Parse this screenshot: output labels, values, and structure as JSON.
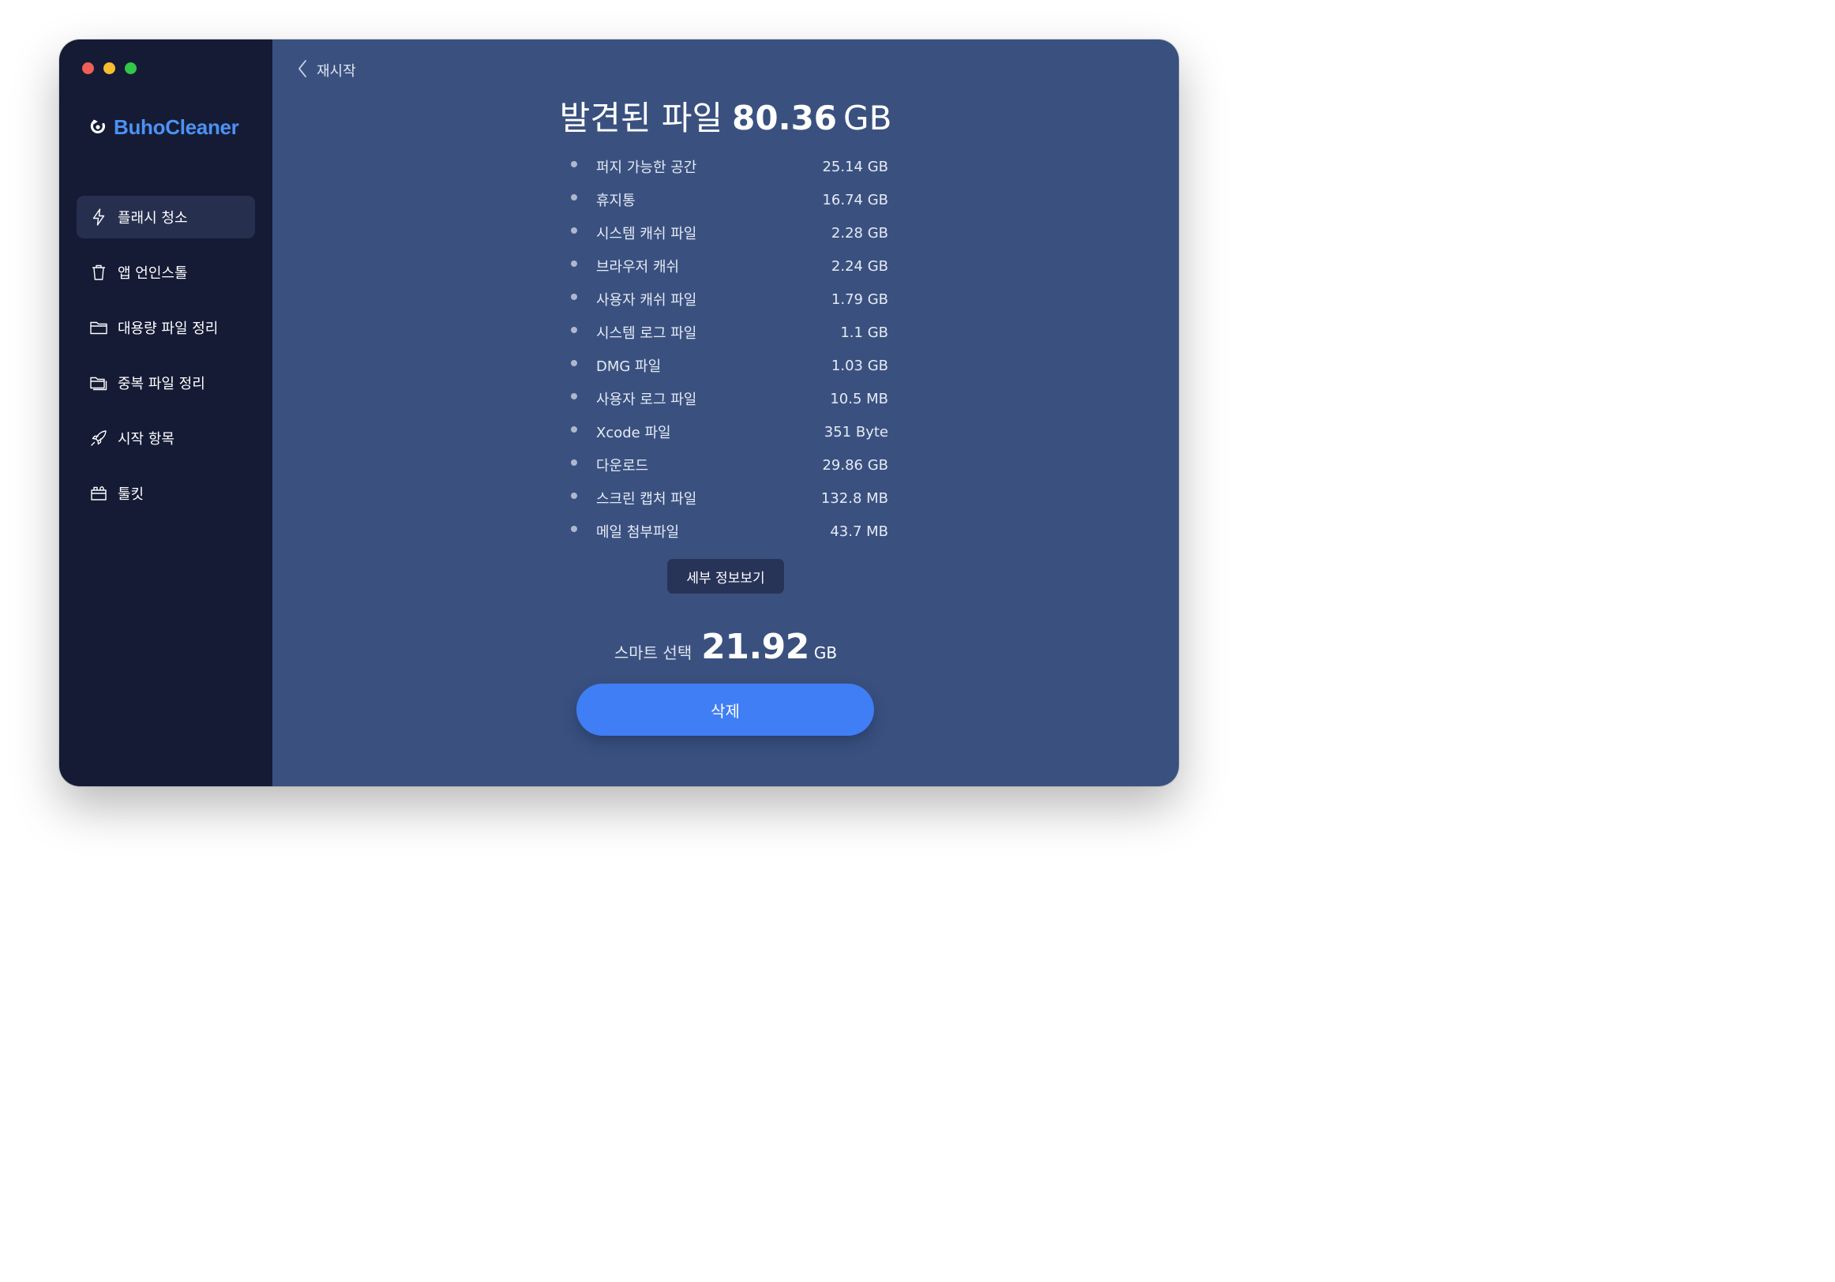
{
  "window": {
    "traffic_lights": [
      "close",
      "minimize",
      "zoom"
    ]
  },
  "sidebar": {
    "logo_text": "BuhoCleaner",
    "logo_icon": "buho-logo-icon",
    "items": [
      {
        "label": "플래시 청소",
        "icon": "lightning-icon",
        "active": true
      },
      {
        "label": "앱 언인스톨",
        "icon": "trash-icon",
        "active": false
      },
      {
        "label": "대용량 파일 정리",
        "icon": "folder-icon",
        "active": false
      },
      {
        "label": "중복 파일 정리",
        "icon": "duplicate-folder-icon",
        "active": false
      },
      {
        "label": "시작 항목",
        "icon": "rocket-icon",
        "active": false
      },
      {
        "label": "툴킷",
        "icon": "toolkit-icon",
        "active": false
      }
    ]
  },
  "main": {
    "back_label": "재시작",
    "title_prefix": "발견된 파일",
    "title_number": "80.36",
    "title_unit": "GB",
    "items": [
      {
        "name": "퍼지 가능한 공간",
        "size": "25.14 GB"
      },
      {
        "name": "휴지통",
        "size": "16.74 GB"
      },
      {
        "name": "시스템 캐쉬 파일",
        "size": "2.28 GB"
      },
      {
        "name": "브라우저 캐쉬",
        "size": "2.24 GB"
      },
      {
        "name": "사용자 캐쉬 파일",
        "size": "1.79 GB"
      },
      {
        "name": "시스템 로그 파일",
        "size": "1.1 GB"
      },
      {
        "name": "DMG 파일",
        "size": "1.03 GB"
      },
      {
        "name": "사용자 로그 파일",
        "size": "10.5 MB"
      },
      {
        "name": "Xcode 파일",
        "size": "351 Byte"
      },
      {
        "name": "다운로드",
        "size": "29.86 GB"
      },
      {
        "name": "스크린 캡처 파일",
        "size": "132.8 MB"
      },
      {
        "name": "메일 첨부파일",
        "size": "43.7 MB"
      }
    ],
    "detail_button": "세부 정보보기",
    "smart_label": "스마트 선택",
    "smart_number": "21.92",
    "smart_unit": "GB",
    "delete_button": "삭제"
  },
  "colors": {
    "sidebar_bg": "#151b35",
    "main_bg": "#3a5180",
    "accent": "#3f7ef4",
    "logo": "#4c92f4"
  }
}
